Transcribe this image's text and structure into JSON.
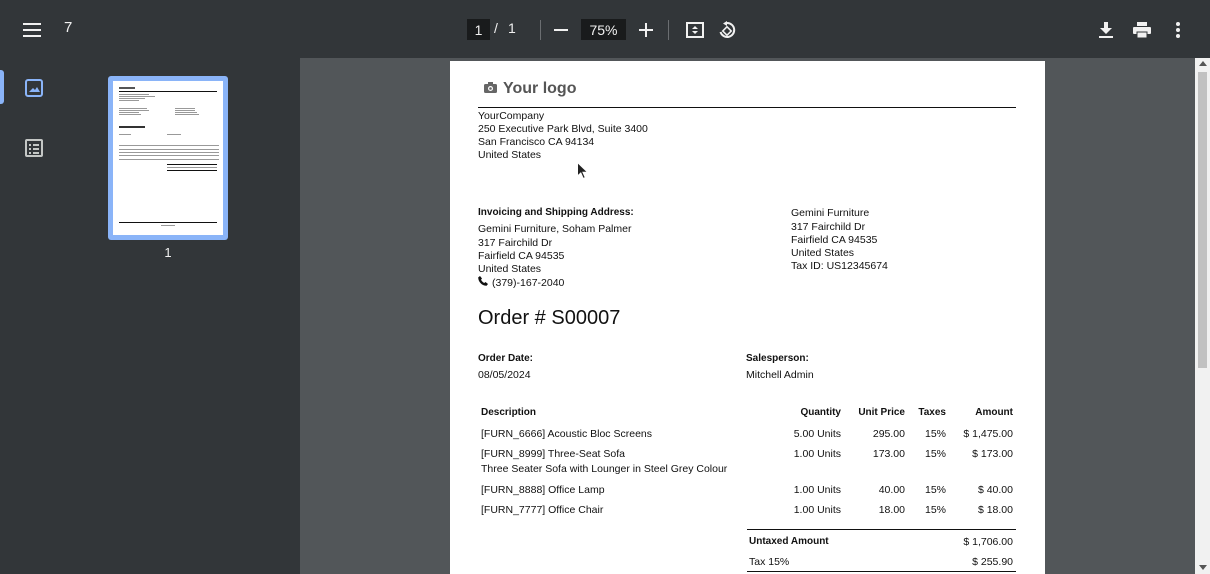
{
  "toolbar": {
    "title": "7",
    "current_page": "1",
    "page_separator": "/",
    "total_pages": "1",
    "zoom": "75%",
    "icons": [
      "menu-icon",
      "zoom-out-icon",
      "zoom-in-icon",
      "fit-page-icon",
      "rotate-icon",
      "download-icon",
      "print-icon",
      "more-icon"
    ]
  },
  "sidebar": {
    "thumbnail_label": "1",
    "icons": [
      "thumbnail-view-icon",
      "outline-view-icon"
    ]
  },
  "document": {
    "logo_text": "Your logo",
    "company": {
      "name": "YourCompany",
      "street": "250 Executive Park Blvd, Suite 3400",
      "city": "San Francisco CA 94134",
      "country": "United States"
    },
    "address_heading": "Invoicing and Shipping Address:",
    "customer": {
      "name": "Gemini Furniture, Soham Palmer",
      "street": "317 Fairchild Dr",
      "city": "Fairfield CA 94535",
      "country": "United States",
      "phone": "(379)-167-2040"
    },
    "partner": {
      "name": "Gemini Furniture",
      "street": "317 Fairchild Dr",
      "city": "Fairfield CA 94535",
      "country": "United States",
      "tax_id": "Tax ID: US12345674"
    },
    "order_title": "Order # S00007",
    "order_date_label": "Order Date:",
    "order_date": "08/05/2024",
    "salesperson_label": "Salesperson:",
    "salesperson": "Mitchell Admin",
    "table_headers": {
      "description": "Description",
      "quantity": "Quantity",
      "unit_price": "Unit Price",
      "taxes": "Taxes",
      "amount": "Amount"
    },
    "lines": [
      {
        "description": "[FURN_6666] Acoustic Bloc Screens",
        "note": "",
        "quantity": "5.00 Units",
        "unit_price": "295.00",
        "taxes": "15%",
        "amount": "$ 1,475.00"
      },
      {
        "description": "[FURN_8999] Three-Seat Sofa",
        "note": "Three Seater Sofa with Lounger in Steel Grey Colour",
        "quantity": "1.00 Units",
        "unit_price": "173.00",
        "taxes": "15%",
        "amount": "$ 173.00"
      },
      {
        "description": "[FURN_8888] Office Lamp",
        "note": "",
        "quantity": "1.00 Units",
        "unit_price": "40.00",
        "taxes": "15%",
        "amount": "$ 40.00"
      },
      {
        "description": "[FURN_7777] Office Chair",
        "note": "",
        "quantity": "1.00 Units",
        "unit_price": "18.00",
        "taxes": "15%",
        "amount": "$ 18.00"
      }
    ],
    "totals": {
      "untaxed_label": "Untaxed Amount",
      "untaxed_value": "$ 1,706.00",
      "tax_label": "Tax 15%",
      "tax_value": "$ 255.90"
    }
  }
}
